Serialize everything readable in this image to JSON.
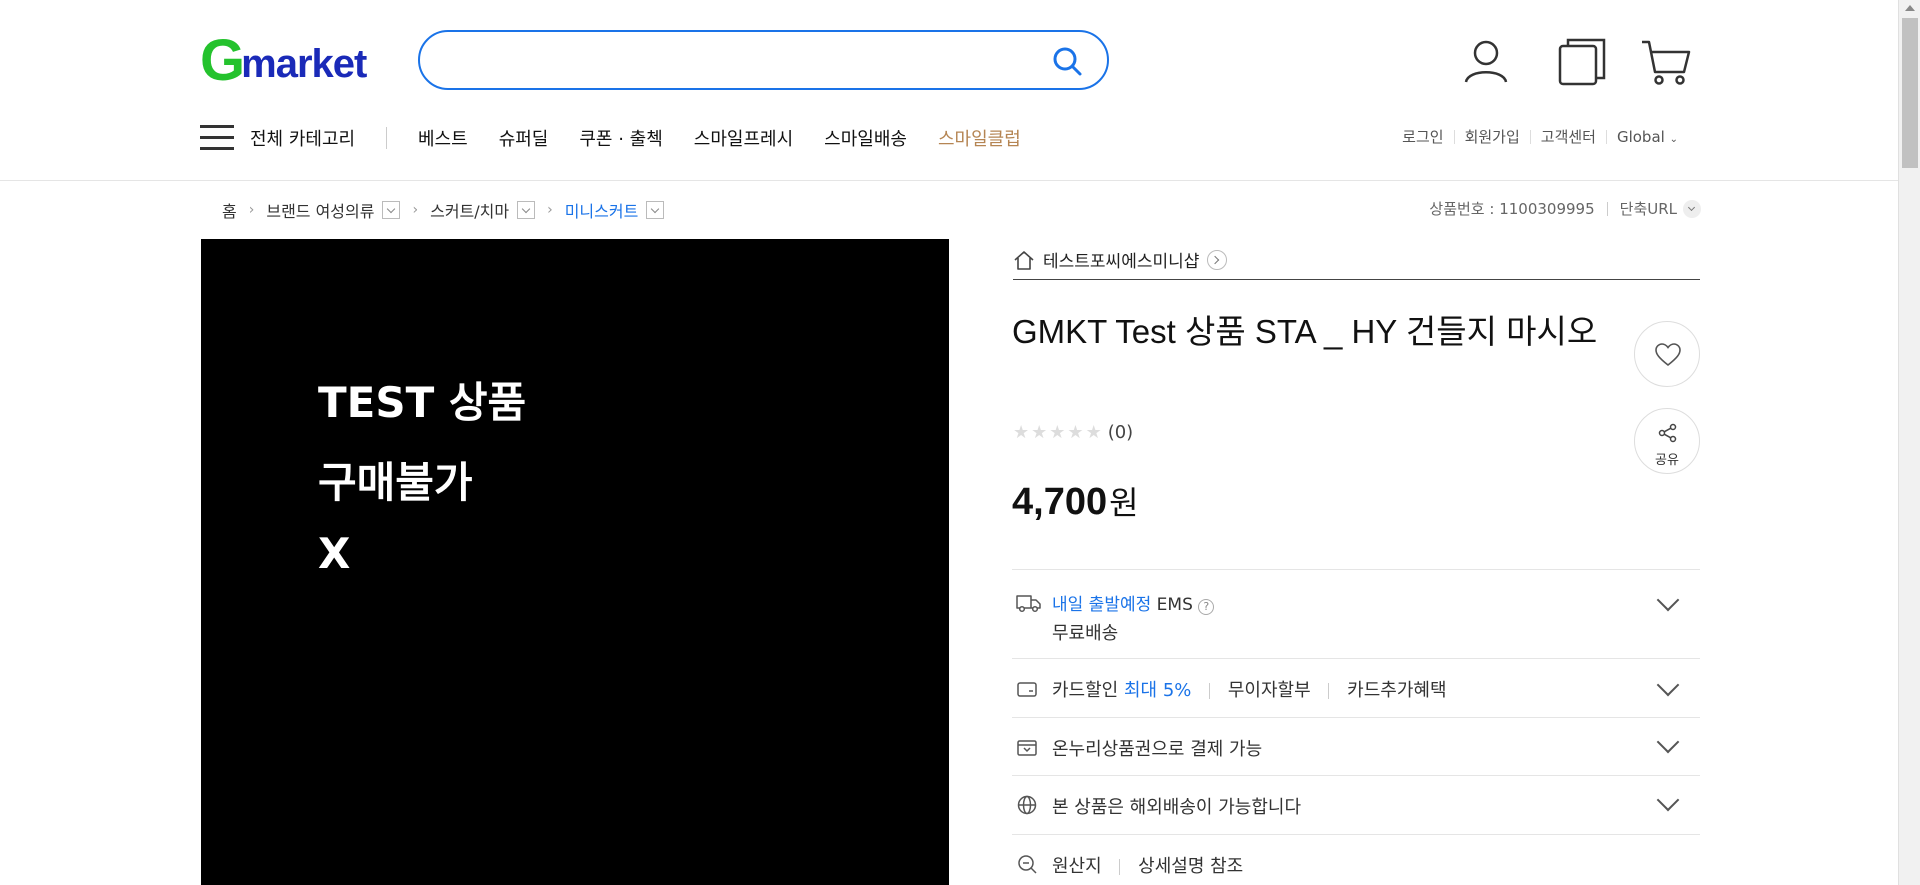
{
  "header": {
    "logo_g": "G",
    "logo_rest": "market",
    "search_placeholder": "",
    "icons": [
      "search-icon",
      "user-icon",
      "recent-items-icon",
      "cart-icon"
    ]
  },
  "nav": {
    "category_label": "전체 카테고리",
    "items": [
      "베스트",
      "슈퍼딜",
      "쿠폰 · 출첵",
      "스마일프레시",
      "스마일배송",
      "스마일클럽"
    ],
    "util": [
      "로그인",
      "회원가입",
      "고객센터",
      "Global"
    ]
  },
  "breadcrumb": [
    "홈",
    "브랜드 여성의류",
    "스커트/치마",
    "미니스커트"
  ],
  "product_no": "상품번호 : 1100309995",
  "short_url": "단축URL",
  "image_text": [
    "TEST 상품",
    "구매불가",
    "X"
  ],
  "shop_name": "테스트포씨에스미니샵",
  "title": "GMKT Test 상품 STA _ HY 건들지 마시오",
  "rating_count": "(0)",
  "price": {
    "value": "4,700",
    "unit": "원"
  },
  "share_label": "공유",
  "info": {
    "delivery_date": "내일 출발예정",
    "delivery_method": "EMS",
    "delivery_help": "?",
    "free_shipping": "무료배송",
    "card_discount": "카드할인",
    "card_max": "최대 5%",
    "installment": "무이자할부",
    "card_extra": "카드추가혜택",
    "onnuri": "온누리상품권으로 결제 가능",
    "overseas": "본 상품은 해외배송이 가능합니다",
    "origin": "원산지",
    "origin_ref": "상세설명 참조"
  },
  "colors": {
    "brand_green": "#24c22d",
    "brand_blue": "#1a2ab8",
    "link_blue": "#1a73e8",
    "club": "#b58553"
  }
}
